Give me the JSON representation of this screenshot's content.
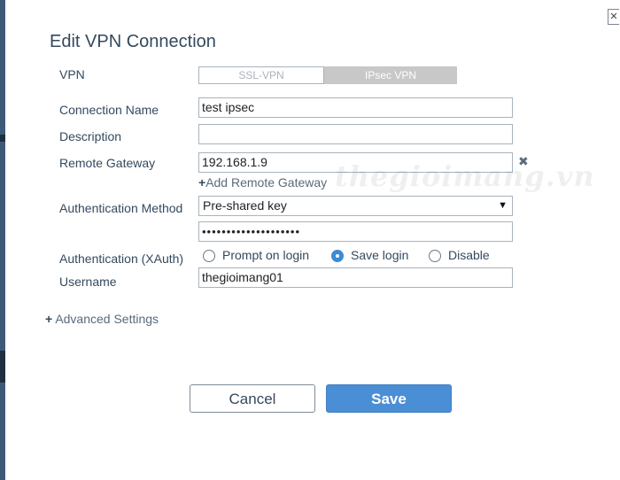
{
  "dialog": {
    "title": "Edit VPN Connection",
    "close_icon": "close-icon"
  },
  "form": {
    "vpn_label": "VPN",
    "vpn_type": {
      "options": [
        "SSL-VPN",
        "IPsec VPN"
      ],
      "selected": "IPsec VPN"
    },
    "connection_name_label": "Connection Name",
    "connection_name_value": "test ipsec",
    "description_label": "Description",
    "description_value": "",
    "remote_gateway_label": "Remote Gateway",
    "remote_gateway_value": "192.168.1.9",
    "remove_gateway_icon": "close-icon",
    "add_gateway_label": "Add Remote Gateway",
    "auth_method_label": "Authentication Method",
    "auth_method_value": "Pre-shared key",
    "psk_value": "••••••••••••••••••••",
    "xauth_label": "Authentication (XAuth)",
    "xauth_options": [
      "Prompt on login",
      "Save login",
      "Disable"
    ],
    "xauth_selected": "Save login",
    "username_label": "Username",
    "username_value": "thegioimang01"
  },
  "advanced_label": "Advanced Settings",
  "buttons": {
    "cancel": "Cancel",
    "save": "Save"
  },
  "watermark": "thegioimang.vn",
  "colors": {
    "primary": "#4a8fd6",
    "text": "#34495e",
    "border": "#a9b3bd"
  }
}
